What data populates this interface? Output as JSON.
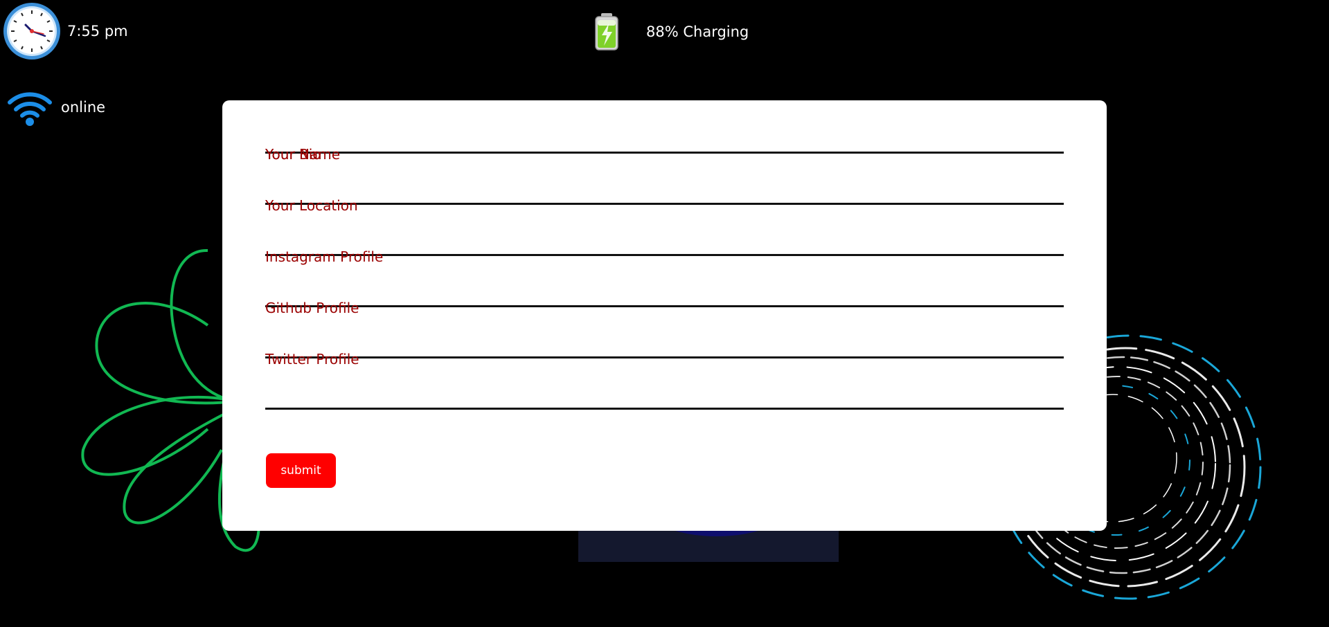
{
  "status": {
    "time": "7:55 pm",
    "battery_label": "88% Charging",
    "battery_level": 88,
    "network": "online"
  },
  "form": {
    "fields": [
      {
        "label": "Your Name",
        "value": ""
      },
      {
        "label": "Your Bio",
        "value": ""
      },
      {
        "label": "Your Location",
        "value": ""
      },
      {
        "label": "Instagram Profile",
        "value": ""
      },
      {
        "label": "Github Profile",
        "value": ""
      },
      {
        "label": "Twitter Profile",
        "value": ""
      }
    ],
    "submit_label": "submit"
  },
  "icons": {
    "clock": "clock-icon",
    "battery": "battery-charging-icon",
    "wifi": "wifi-icon"
  },
  "colors": {
    "background": "#000000",
    "card": "#ffffff",
    "label": "#9b0000",
    "button": "#ff0000"
  }
}
